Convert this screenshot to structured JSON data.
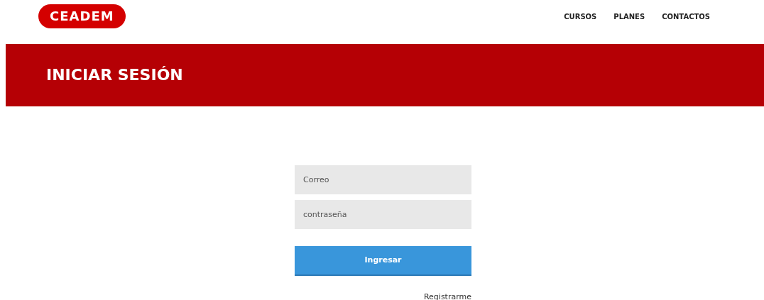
{
  "logo": {
    "text": "CEADEM"
  },
  "nav": [
    {
      "label": "CURSOS"
    },
    {
      "label": "PLANES"
    },
    {
      "label": "CONTACTOS"
    }
  ],
  "banner": {
    "title": "INICIAR SESIÓN"
  },
  "form": {
    "fields": [
      {
        "placeholder": "Correo"
      },
      {
        "placeholder": "contraseña"
      }
    ],
    "submit": "Ingresar",
    "link": "Registrarme"
  }
}
